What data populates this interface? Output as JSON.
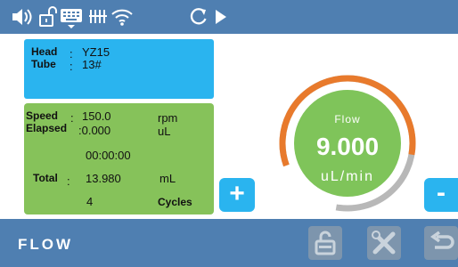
{
  "statusbar": {
    "icons": [
      "speaker-icon",
      "unlock-icon",
      "keyboard-icon",
      "usb-grid-icon",
      "wifi-icon",
      "refresh-icon",
      "play-icon"
    ]
  },
  "head_panel": {
    "head_label": "Head",
    "head_sep": ":",
    "head_value": "YZ15",
    "tube_label": "Tube",
    "tube_sep": ":",
    "tube_value": "13#"
  },
  "run_panel": {
    "speed_label": "Speed",
    "speed_sep": ":",
    "speed_value": "150.0",
    "speed_unit": "rpm",
    "elapsed_label": "Elapsed",
    "elapsed_value": ":0.000",
    "elapsed_unit": "uL",
    "elapsed_time": "00:00:00",
    "total_label": "Total",
    "total_sep": ":",
    "total_value": "13.980",
    "total_unit": "mL",
    "cycles_value": "4",
    "cycles_label": "Cycles"
  },
  "gauge": {
    "title": "Flow",
    "value": "9.000",
    "unit": "uL/min",
    "level": 0.7,
    "colors": {
      "fill": "#7fc45a",
      "arc": "#e87a2c",
      "track": "#b8b8b8"
    }
  },
  "controls": {
    "plus_label": "+",
    "minus_label": "-"
  },
  "bottombar": {
    "mode_label": "FLOW",
    "buttons": [
      "lock-icon",
      "tools-icon",
      "back-icon"
    ]
  },
  "colors": {
    "bar": "#4f7fb1",
    "blue_panel": "#2ab4ef",
    "green_panel": "#86c25a"
  }
}
